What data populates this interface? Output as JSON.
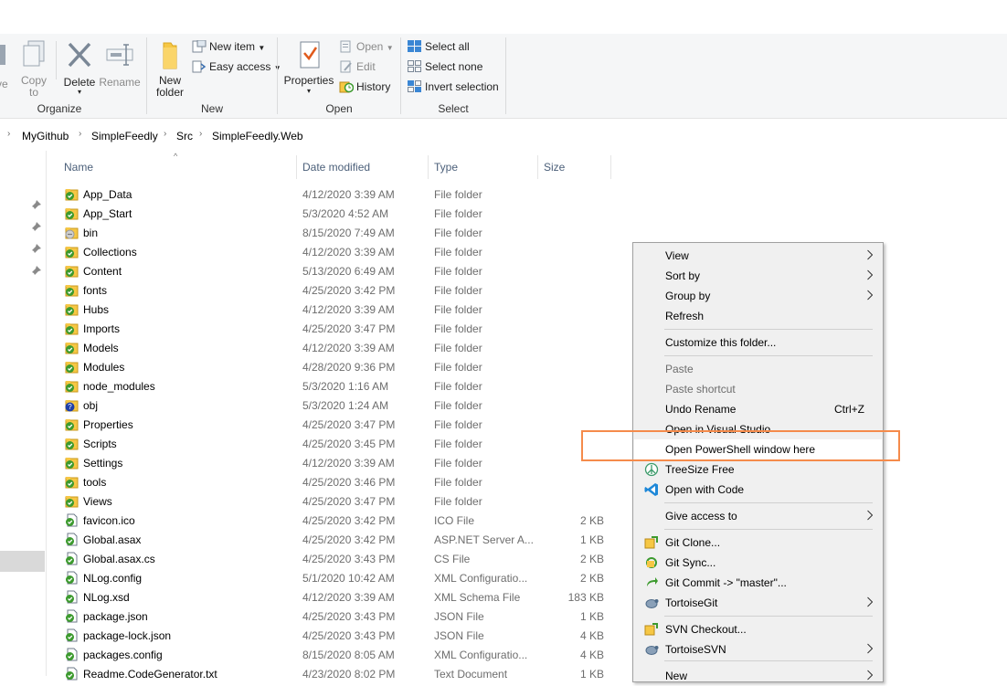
{
  "ribbon": {
    "organize": {
      "label": "Organize",
      "move_partial": "ve",
      "copy_to": [
        "Copy",
        "to"
      ],
      "delete": "Delete",
      "rename": "Rename"
    },
    "new": {
      "label": "New",
      "new_folder": [
        "New",
        "folder"
      ],
      "new_item": "New item",
      "easy_access": "Easy access"
    },
    "open": {
      "label": "Open",
      "properties": "Properties",
      "open": "Open",
      "edit": "Edit",
      "history": "History"
    },
    "select": {
      "label": "Select",
      "select_all": "Select all",
      "select_none": "Select none",
      "invert_selection": "Invert selection"
    }
  },
  "breadcrumb": [
    "MyGithub",
    "SimpleFeedly",
    "Src",
    "SimpleFeedly.Web"
  ],
  "columns": {
    "name": "Name",
    "date": "Date modified",
    "type": "Type",
    "size": "Size"
  },
  "files": [
    {
      "name": "App_Data",
      "date": "4/12/2020 3:39 AM",
      "type": "File folder",
      "size": "",
      "icon": "folder-ok"
    },
    {
      "name": "App_Start",
      "date": "5/3/2020 4:52 AM",
      "type": "File folder",
      "size": "",
      "icon": "folder-ok"
    },
    {
      "name": "bin",
      "date": "8/15/2020 7:49 AM",
      "type": "File folder",
      "size": "",
      "icon": "folder-ignored"
    },
    {
      "name": "Collections",
      "date": "4/12/2020 3:39 AM",
      "type": "File folder",
      "size": "",
      "icon": "folder-ok"
    },
    {
      "name": "Content",
      "date": "5/13/2020 6:49 AM",
      "type": "File folder",
      "size": "",
      "icon": "folder-ok"
    },
    {
      "name": "fonts",
      "date": "4/25/2020 3:42 PM",
      "type": "File folder",
      "size": "",
      "icon": "folder-ok"
    },
    {
      "name": "Hubs",
      "date": "4/12/2020 3:39 AM",
      "type": "File folder",
      "size": "",
      "icon": "folder-ok"
    },
    {
      "name": "Imports",
      "date": "4/25/2020 3:47 PM",
      "type": "File folder",
      "size": "",
      "icon": "folder-ok"
    },
    {
      "name": "Models",
      "date": "4/12/2020 3:39 AM",
      "type": "File folder",
      "size": "",
      "icon": "folder-ok"
    },
    {
      "name": "Modules",
      "date": "4/28/2020 9:36 PM",
      "type": "File folder",
      "size": "",
      "icon": "folder-ok"
    },
    {
      "name": "node_modules",
      "date": "5/3/2020 1:16 AM",
      "type": "File folder",
      "size": "",
      "icon": "folder-ok"
    },
    {
      "name": "obj",
      "date": "5/3/2020 1:24 AM",
      "type": "File folder",
      "size": "",
      "icon": "folder-unversioned"
    },
    {
      "name": "Properties",
      "date": "4/25/2020 3:47 PM",
      "type": "File folder",
      "size": "",
      "icon": "folder-ok"
    },
    {
      "name": "Scripts",
      "date": "4/25/2020 3:45 PM",
      "type": "File folder",
      "size": "",
      "icon": "folder-ok"
    },
    {
      "name": "Settings",
      "date": "4/12/2020 3:39 AM",
      "type": "File folder",
      "size": "",
      "icon": "folder-ok"
    },
    {
      "name": "tools",
      "date": "4/25/2020 3:46 PM",
      "type": "File folder",
      "size": "",
      "icon": "folder-ok"
    },
    {
      "name": "Views",
      "date": "4/25/2020 3:47 PM",
      "type": "File folder",
      "size": "",
      "icon": "folder-ok"
    },
    {
      "name": "favicon.ico",
      "date": "4/25/2020 3:42 PM",
      "type": "ICO File",
      "size": "2 KB",
      "icon": "file-ok"
    },
    {
      "name": "Global.asax",
      "date": "4/25/2020 3:42 PM",
      "type": "ASP.NET Server A...",
      "size": "1 KB",
      "icon": "file-ok"
    },
    {
      "name": "Global.asax.cs",
      "date": "4/25/2020 3:43 PM",
      "type": "CS File",
      "size": "2 KB",
      "icon": "file-ok"
    },
    {
      "name": "NLog.config",
      "date": "5/1/2020 10:42 AM",
      "type": "XML Configuratio...",
      "size": "2 KB",
      "icon": "file-ok"
    },
    {
      "name": "NLog.xsd",
      "date": "4/12/2020 3:39 AM",
      "type": "XML Schema File",
      "size": "183 KB",
      "icon": "file-ok"
    },
    {
      "name": "package.json",
      "date": "4/25/2020 3:43 PM",
      "type": "JSON File",
      "size": "1 KB",
      "icon": "file-ok"
    },
    {
      "name": "package-lock.json",
      "date": "4/25/2020 3:43 PM",
      "type": "JSON File",
      "size": "4 KB",
      "icon": "file-ok"
    },
    {
      "name": "packages.config",
      "date": "8/15/2020 8:05 AM",
      "type": "XML Configuratio...",
      "size": "4 KB",
      "icon": "file-ok"
    },
    {
      "name": "Readme.CodeGenerator.txt",
      "date": "4/23/2020 8:02 PM",
      "type": "Text Document",
      "size": "1 KB",
      "icon": "file-ok"
    }
  ],
  "context_menu": {
    "items": [
      {
        "label": "View",
        "submenu": true
      },
      {
        "label": "Sort by",
        "submenu": true
      },
      {
        "label": "Group by",
        "submenu": true
      },
      {
        "label": "Refresh"
      },
      {
        "label": "Customize this folder..."
      },
      {
        "label": "Paste",
        "disabled": true
      },
      {
        "label": "Paste shortcut",
        "disabled": true
      },
      {
        "label": "Undo Rename",
        "shortcut": "Ctrl+Z"
      },
      {
        "label": "Open in Visual Studio"
      },
      {
        "label": "Open PowerShell window here",
        "highlighted": true
      },
      {
        "label": "TreeSize Free",
        "icon": "treesize-icon"
      },
      {
        "label": "Open with Code",
        "icon": "vscode-icon"
      },
      {
        "label": "Give access to",
        "submenu": true
      },
      {
        "label": "Git Clone...",
        "icon": "git-clone-icon"
      },
      {
        "label": "Git Sync...",
        "icon": "git-sync-icon"
      },
      {
        "label": "Git Commit -> \"master\"...",
        "icon": "git-commit-icon"
      },
      {
        "label": "TortoiseGit",
        "icon": "tortoisegit-icon",
        "submenu": true
      },
      {
        "label": "SVN Checkout...",
        "icon": "svn-checkout-icon"
      },
      {
        "label": "TortoiseSVN",
        "icon": "tortoisesvn-icon",
        "submenu": true
      },
      {
        "label": "New",
        "submenu": true
      }
    ]
  },
  "colors": {
    "highlight_box": "#f58b4b",
    "folder": "#f6c744",
    "ok_badge": "#3c9a2e"
  }
}
